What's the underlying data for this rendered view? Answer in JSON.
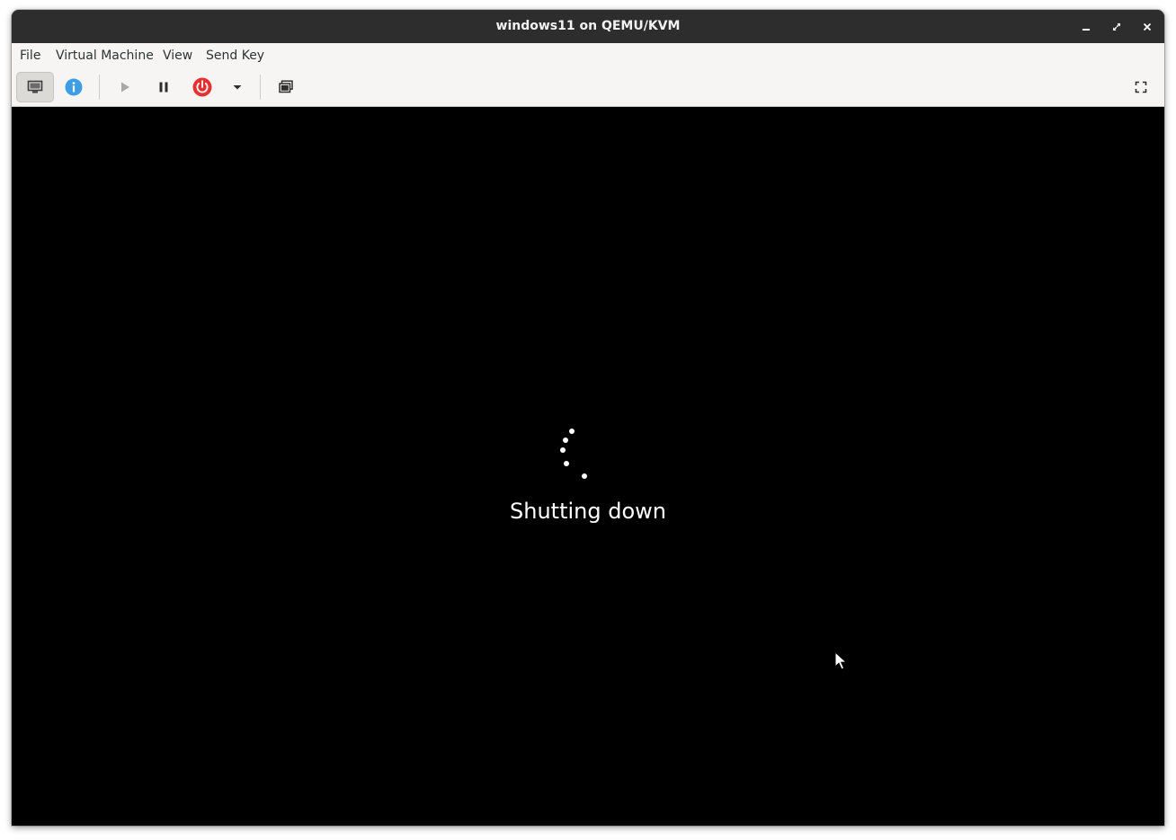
{
  "window": {
    "title": "windows11 on QEMU/KVM"
  },
  "window_controls": {
    "minimize_icon": "minimize-icon",
    "maximize_icon": "restore-icon",
    "close_icon": "close-icon"
  },
  "menubar": {
    "items": [
      {
        "label": "File"
      },
      {
        "label": "Virtual Machine"
      },
      {
        "label": "View"
      },
      {
        "label": "Send Key"
      }
    ]
  },
  "toolbar": {
    "buttons": [
      {
        "name": "console",
        "icon": "monitor-icon",
        "active": true
      },
      {
        "name": "details",
        "icon": "info-icon",
        "color": "#3d9ee5"
      },
      {
        "name": "run",
        "icon": "play-icon",
        "disabled": true
      },
      {
        "name": "pause",
        "icon": "pause-icon"
      },
      {
        "name": "shutdown",
        "icon": "power-icon",
        "color": "#e5312f"
      },
      {
        "name": "shutdown-menu",
        "icon": "chevron-down-icon"
      },
      {
        "name": "snapshots",
        "icon": "snapshots-icon"
      },
      {
        "name": "fullscreen",
        "icon": "fullscreen-icon"
      }
    ]
  },
  "vm_screen": {
    "status": "Shutting down",
    "spinner_icon": "loading-spinner-icon"
  }
}
